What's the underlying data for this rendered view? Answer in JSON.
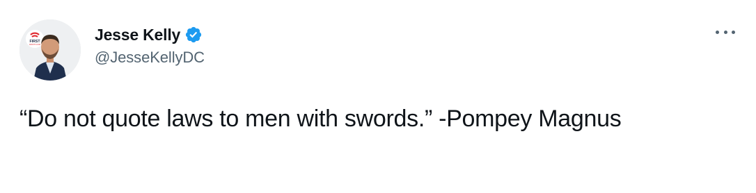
{
  "author": {
    "display_name": "Jesse Kelly",
    "handle": "@JesseKellyDC",
    "verified": true,
    "avatar_logo_text": "THE FIRST",
    "avatar_logo_subtext": "FIRSTTV.COM"
  },
  "tweet": {
    "text": "“Do not quote laws to men with swords.” -Pompey Magnus"
  },
  "icons": {
    "verified_badge": "verified-badge-icon",
    "more_options": "more-options-icon"
  },
  "colors": {
    "text_primary": "#0f1419",
    "text_secondary": "#536471",
    "verified_blue": "#1d9bf0",
    "logo_red": "#e0262d"
  }
}
